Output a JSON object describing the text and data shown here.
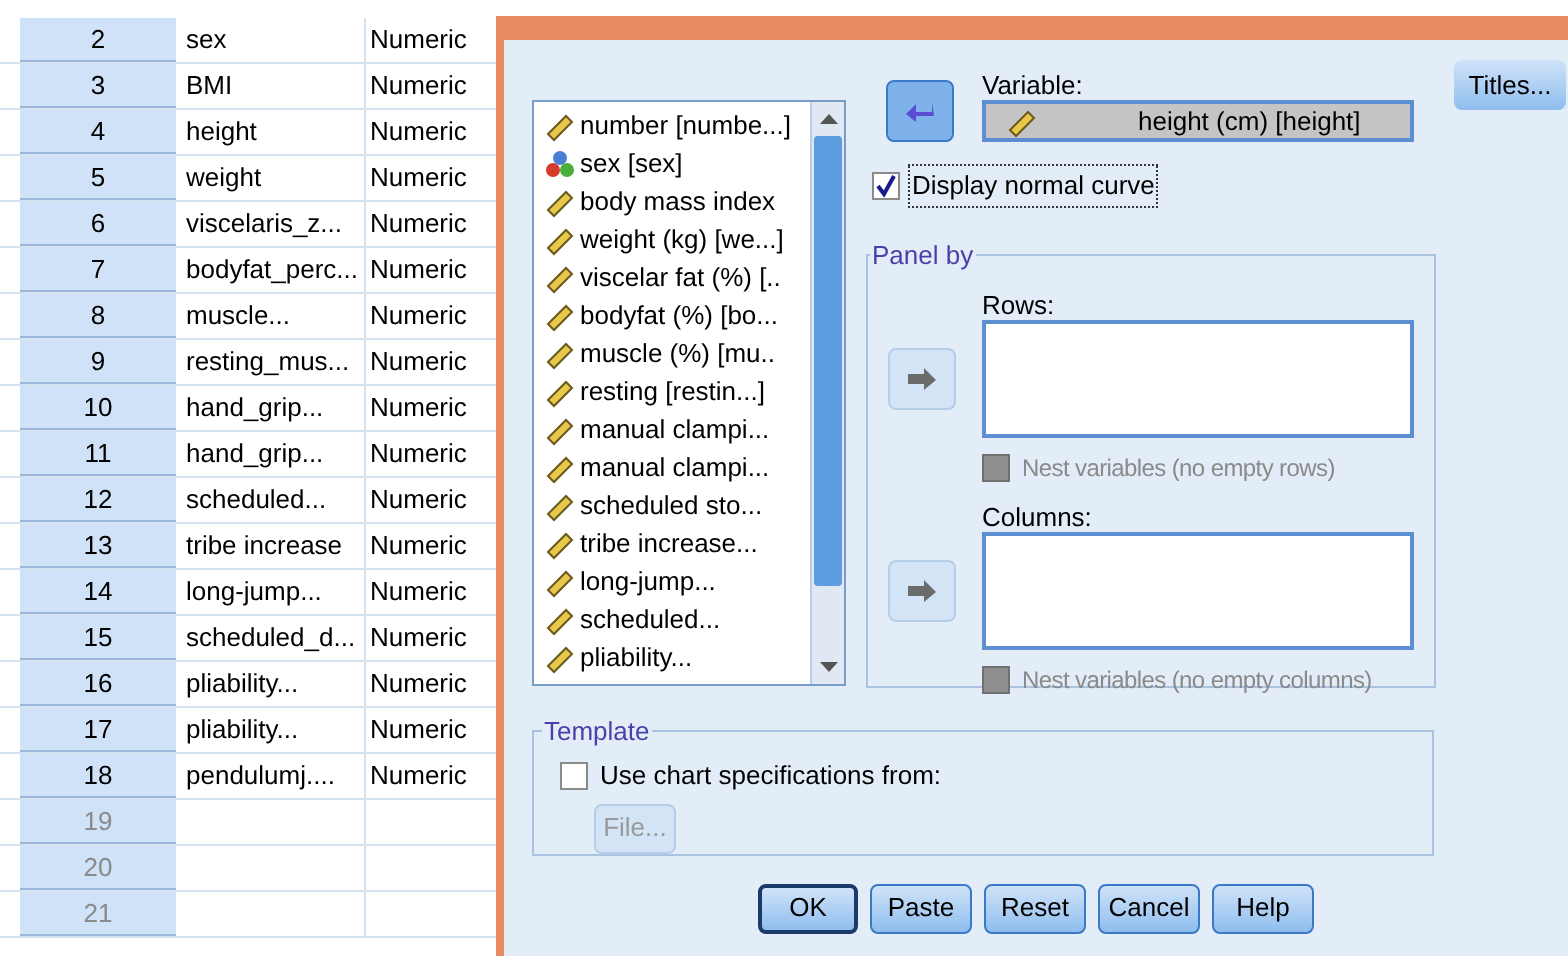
{
  "data_view": {
    "rows": [
      {
        "number": "2",
        "name": "sex",
        "type": "Numeric"
      },
      {
        "number": "3",
        "name": "BMI",
        "type": "Numeric"
      },
      {
        "number": "4",
        "name": "height",
        "type": "Numeric"
      },
      {
        "number": "5",
        "name": "weight",
        "type": "Numeric"
      },
      {
        "number": "6",
        "name": "viscelaris_z...",
        "type": "Numeric"
      },
      {
        "number": "7",
        "name": "bodyfat_perc...",
        "type": "Numeric"
      },
      {
        "number": "8",
        "name": "muscle...",
        "type": "Numeric"
      },
      {
        "number": "9",
        "name": "resting_mus...",
        "type": "Numeric"
      },
      {
        "number": "10",
        "name": "hand_grip...",
        "type": "Numeric"
      },
      {
        "number": "11",
        "name": "hand_grip...",
        "type": "Numeric"
      },
      {
        "number": "12",
        "name": "scheduled...",
        "type": "Numeric"
      },
      {
        "number": "13",
        "name": "tribe increase",
        "type": "Numeric"
      },
      {
        "number": "14",
        "name": "long-jump...",
        "type": "Numeric"
      },
      {
        "number": "15",
        "name": "scheduled_d...",
        "type": "Numeric"
      },
      {
        "number": "16",
        "name": "pliability...",
        "type": "Numeric"
      },
      {
        "number": "17",
        "name": "pliability...",
        "type": "Numeric"
      },
      {
        "number": "18",
        "name": "pendulumj....",
        "type": "Numeric"
      },
      {
        "number": "19"
      },
      {
        "number": "20"
      },
      {
        "number": "21"
      }
    ]
  },
  "dialog": {
    "variables": [
      {
        "label": "number [numbe...]",
        "kind": "scale"
      },
      {
        "label": "sex [sex]",
        "kind": "nominal"
      },
      {
        "label": "body mass index",
        "kind": "scale"
      },
      {
        "label": "weight (kg) [we...]",
        "kind": "scale"
      },
      {
        "label": "viscelar fat (%) [..",
        "kind": "scale"
      },
      {
        "label": "bodyfat (%) [bo...",
        "kind": "scale"
      },
      {
        "label": "muscle (%) [mu..",
        "kind": "scale"
      },
      {
        "label": "resting [restin...]",
        "kind": "scale"
      },
      {
        "label": "manual clampi...",
        "kind": "scale"
      },
      {
        "label": "manual clampi...",
        "kind": "scale"
      },
      {
        "label": "scheduled sto...",
        "kind": "scale"
      },
      {
        "label": "tribe increase...",
        "kind": "scale"
      },
      {
        "label": "long-jump...",
        "kind": "scale"
      },
      {
        "label": "scheduled...",
        "kind": "scale"
      },
      {
        "label": "pliability...",
        "kind": "scale"
      }
    ],
    "variable": {
      "label": "Variable:",
      "value": "height (cm) [height]",
      "kind": "scale",
      "arrow_disabled": false
    },
    "titles_button": "Titles...",
    "normal_curve": {
      "label": "Display normal curve",
      "checked": true
    },
    "panel_by": {
      "legend": "Panel by",
      "rows": {
        "label": "Rows:",
        "arrow_disabled": true,
        "nest": {
          "label": "Nest variables (no empty rows)",
          "checked": false,
          "disabled": true
        }
      },
      "columns": {
        "label": "Columns:",
        "arrow_disabled": true,
        "nest": {
          "label": "Nest variables (no empty columns)",
          "checked": false,
          "disabled": true
        }
      }
    },
    "template": {
      "legend": "Template",
      "use_spec": {
        "label": "Use chart specifications from:",
        "checked": false
      },
      "file_button": {
        "label": "File...",
        "disabled": true
      }
    },
    "buttons": [
      {
        "label": "OK",
        "selected": true
      },
      {
        "label": "Paste",
        "selected": false
      },
      {
        "label": "Reset",
        "selected": false
      },
      {
        "label": "Cancel",
        "selected": false
      },
      {
        "label": "Help",
        "selected": false
      }
    ]
  }
}
